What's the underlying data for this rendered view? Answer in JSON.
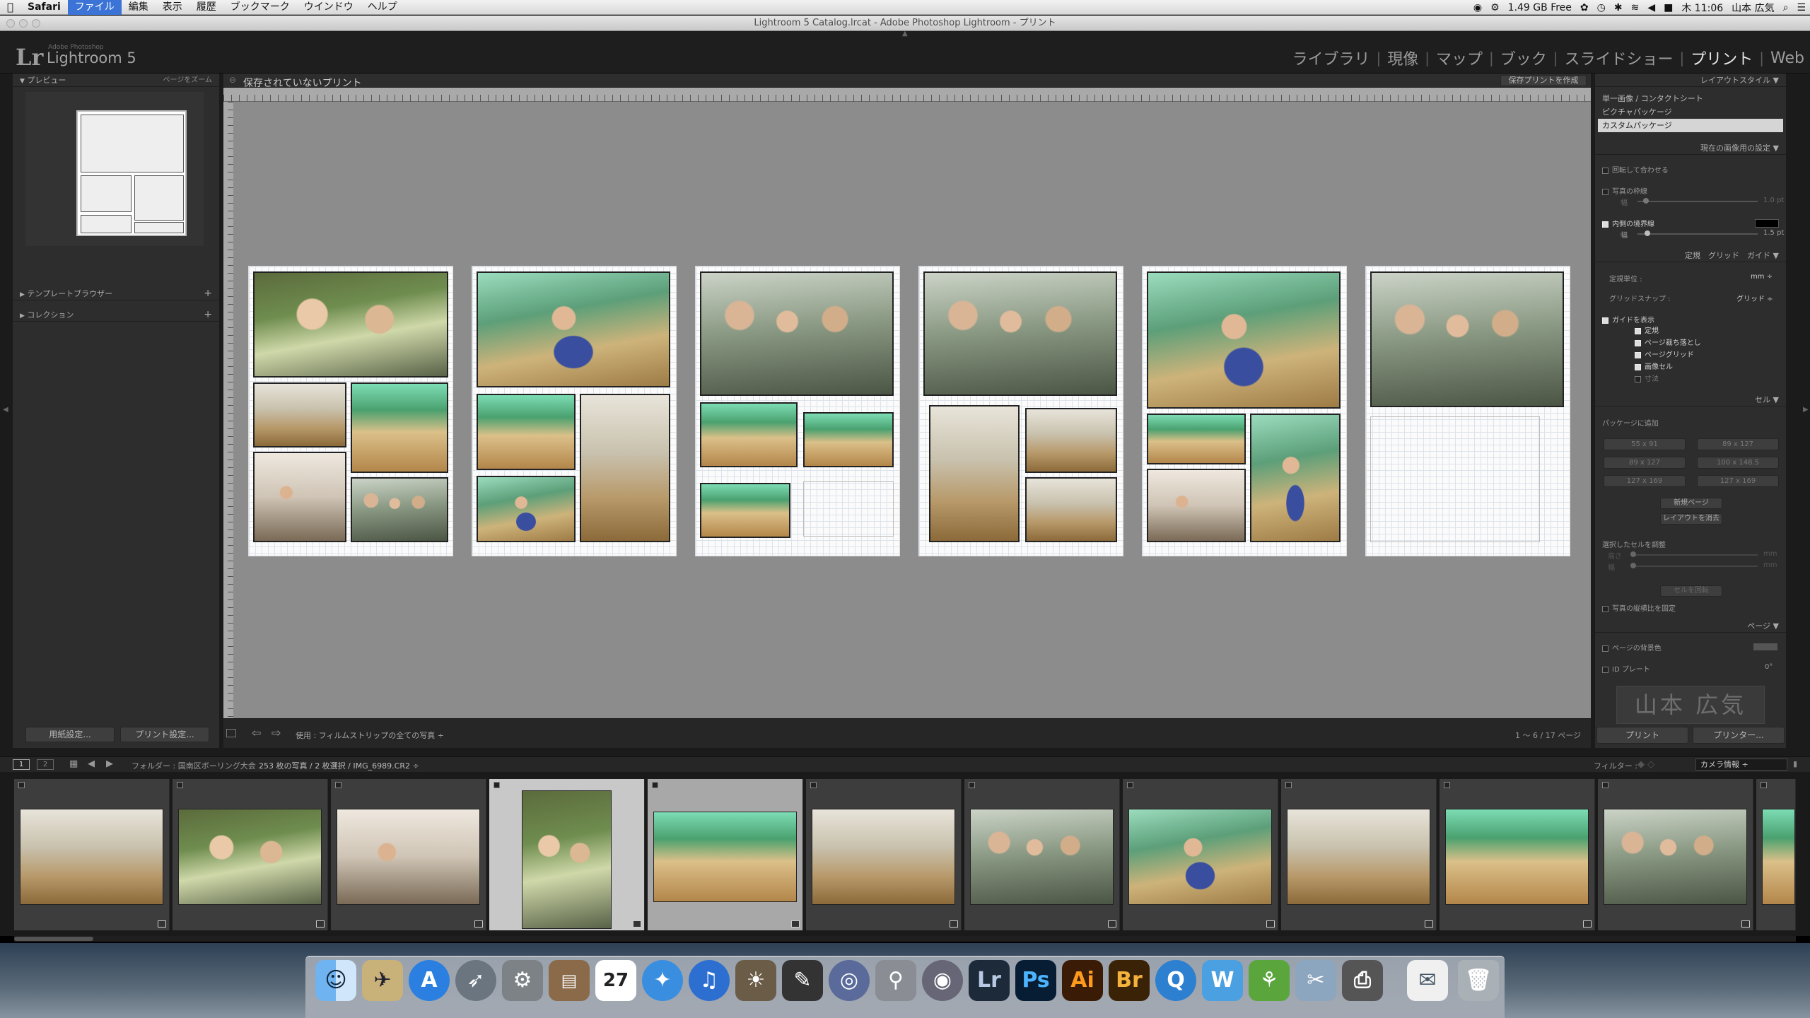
{
  "menubar": {
    "apple": "",
    "items": [
      "Safari",
      "ファイル",
      "編集",
      "表示",
      "履歴",
      "ブックマーク",
      "ウインドウ",
      "ヘルプ"
    ],
    "status": {
      "memory": "1.49 GB Free",
      "clock": "木 11:06",
      "user": "山本 広気"
    }
  },
  "window": {
    "title": "Lightroom 5 Catalog.lrcat - Adobe Photoshop Lightroom - プリント"
  },
  "lr": {
    "logo": "Lr",
    "brand_small": "Adobe Photoshop",
    "brand": "Lightroom 5",
    "modules": [
      "ライブラリ",
      "現像",
      "マップ",
      "ブック",
      "スライドショー",
      "プリント",
      "Web"
    ],
    "active_module": "プリント"
  },
  "left": {
    "preview_title": "プレビュー",
    "preview_zoom": "ページをズーム",
    "template_browser": "テンプレートブラウザー",
    "collections": "コレクション",
    "page_setup": "用紙設定...",
    "print_settings": "プリント設定..."
  },
  "center": {
    "title": "保存されていないプリント",
    "save_btn": "保存プリントを作成",
    "use_label": "使用 : フィルムストリップの全ての写真 ÷",
    "page_count": "1 ～ 6 / 17 ページ"
  },
  "right": {
    "layout_style": "レイアウトスタイル",
    "styles": [
      "単一画像 / コンタクトシート",
      "ピクチャパッケージ",
      "カスタムパッケージ"
    ],
    "image_settings": "現在の画像用の設定",
    "rotate_fit": "回転して合わせる",
    "photo_border": "写真の枠線",
    "border_width_label": "幅",
    "border_width_val": "1.0 pt",
    "inner_stroke": "内側の境界線",
    "inner_width_label": "幅",
    "inner_width_val": "1.5 pt",
    "ruler_tabs": [
      "定規",
      "グリッド",
      "ガイド"
    ],
    "ruler_units_label": "定規単位 :",
    "ruler_units_val": "mm ÷",
    "grid_snap_label": "グリッドスナップ :",
    "grid_snap_val": "グリッド ÷",
    "show_guides": "ガイドを表示",
    "guides": [
      "定規",
      "ページ裁ち落とし",
      "ページグリッド",
      "画像セル",
      "寸法"
    ],
    "cells": "セル",
    "add_to_package": "パッケージに追加",
    "sizes": [
      "55 x 91",
      "89 x 127",
      "89 x 127",
      "100 x 148.5",
      "127 x 169",
      "127 x 169"
    ],
    "new_page": "新規ページ",
    "clear_layout": "レイアウトを消去",
    "adjust_cell": "選択したセルを調整",
    "adj_h": "高さ",
    "adj_w": "幅",
    "unit": "mm",
    "rotate_cell": "セルを回転",
    "lock_aspect": "写真の縦横比を固定",
    "page": "ページ",
    "page_bg": "ページの背景色",
    "identity": "ID プレート",
    "identity_angle": "0°",
    "identity_name": "山本 広気",
    "print_btn": "プリント",
    "printer_btn": "プリンター..."
  },
  "filmbar": {
    "pages": [
      "1",
      "2"
    ],
    "folder": "フォルダー : 国南区ボーリング大会",
    "count": "253 枚の写真 / 2 枚選択 / IMG_6989.CR2 ÷",
    "filter_label": "フィルター :",
    "filter_val": "カメラ情報 ÷"
  },
  "dock": {
    "icons": [
      "Finder",
      "Mail",
      "App Store",
      "Launchpad",
      "System Preferences",
      "Photo Browser",
      "Calendar",
      "Safari",
      "iTunes",
      "iPhoto",
      "Final Cut Pro",
      "Motion",
      "Preview",
      "DVD Player",
      "Lr",
      "Ps",
      "Ai",
      "Br",
      "QuickTime",
      "Wunderlist",
      "Network",
      "Scanner",
      "Printer",
      "Mail",
      "Trash"
    ],
    "calendar_day": "27"
  },
  "colors": {
    "lr_bg": "#1e1e1e",
    "panel": "#2d2d2d",
    "canvas": "#8a8a8a",
    "accent": "#3b74d6"
  }
}
